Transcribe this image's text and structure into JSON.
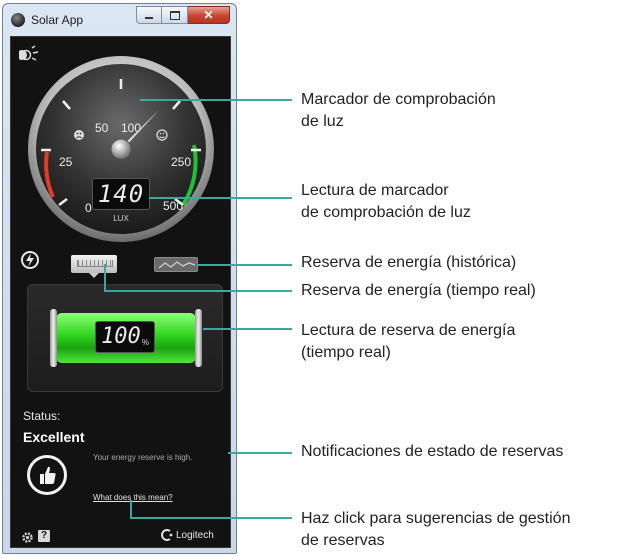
{
  "window": {
    "title": "Solar App",
    "close_glyph": "✕"
  },
  "gauge": {
    "ticks": [
      "0",
      "25",
      "50",
      "100",
      "250",
      "500"
    ],
    "reading": "140",
    "unit": "LUX",
    "needle_value": "100"
  },
  "reserve": {
    "reading": "100",
    "unit": "%",
    "level_percent": 100
  },
  "status": {
    "label": "Status:",
    "value": "Excellent",
    "message": "Your energy reserve is high.",
    "help_link": "What does this mean?"
  },
  "footer": {
    "help": "?",
    "brand": "Logitech"
  },
  "callouts": [
    {
      "lines": [
        "Marcador de comprobación",
        "de luz"
      ]
    },
    {
      "lines": [
        "Lectura de marcador",
        "de comprobación de luz"
      ]
    },
    {
      "lines": [
        "Reserva de energía (histórica)"
      ]
    },
    {
      "lines": [
        "Reserva de energía (tiempo real)"
      ]
    },
    {
      "lines": [
        "Lectura de reserva de energía",
        "(tiempo real)"
      ]
    },
    {
      "lines": [
        "Notificaciones de estado de reservas"
      ]
    },
    {
      "lines": [
        "Haz click para sugerencias de gestión",
        "de reservas"
      ]
    }
  ],
  "colors": {
    "callout_line": "#3aa7a0",
    "battery_green": "#2fd41c",
    "gauge_red": "#e23b2a",
    "gauge_green": "#22c12e"
  }
}
